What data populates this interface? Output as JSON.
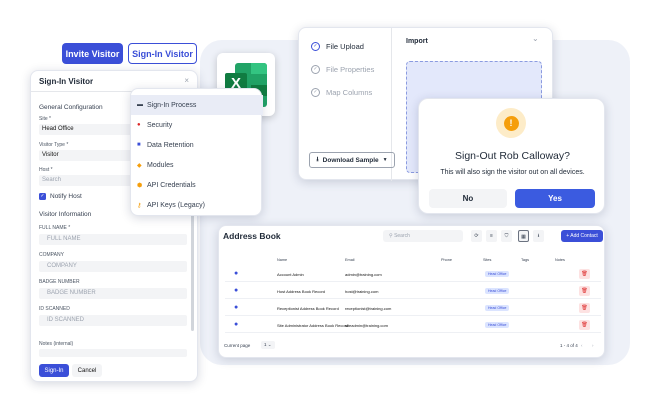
{
  "actions": {
    "invite": "Invite Visitor",
    "signin": "Sign-In Visitor"
  },
  "signin_dialog": {
    "title": "Sign-In Visitor",
    "close": "×",
    "general": "General Configuration",
    "site_label": "Site *",
    "site_value": "Head Office",
    "type_label": "Visitor Type *",
    "type_value": "Visitor",
    "host_label": "Host *",
    "host_placeholder": "Search",
    "notify": "Notify Host",
    "visitor_info": "Visitor Information",
    "full_name_label": "FULL NAME *",
    "full_name_ph": "FULL NAME",
    "company_label": "COMPANY",
    "company_ph": "COMPANY",
    "badge_label": "BADGE NUMBER",
    "badge_ph": "BADGE NUMBER",
    "id_label": "ID SCANNED",
    "id_ph": "ID SCANNED",
    "notes_label": "Notes (internal)",
    "signin_btn": "Sign-In",
    "cancel_btn": "Cancel"
  },
  "menu": [
    {
      "label": "Sign-In Process",
      "icon": "▬",
      "color": "#374151"
    },
    {
      "label": "Security",
      "icon": "●",
      "color": "#dc2626"
    },
    {
      "label": "Data Retention",
      "icon": "■",
      "color": "#3b4fd8"
    },
    {
      "label": "Modules",
      "icon": "◆",
      "color": "#f59e0b"
    },
    {
      "label": "API Credentials",
      "icon": "⬢",
      "color": "#f59e0b"
    },
    {
      "label": "API Keys (Legacy)",
      "icon": "🔑",
      "color": "#f59e0b"
    }
  ],
  "excel": {
    "letter": "X"
  },
  "import_dialog": {
    "steps": [
      "File Upload",
      "File Properties",
      "Map Columns"
    ],
    "import_label": "Import",
    "chevron": "⌄",
    "download": "Download Sample"
  },
  "signout": {
    "icon": "!",
    "title": "Sign-Out Rob Calloway?",
    "subtitle": "This will also sign the visitor out on all devices.",
    "no": "No",
    "yes": "Yes"
  },
  "address_book": {
    "title": "Address Book",
    "search_placeholder": "Search",
    "add": "+ Add Contact",
    "columns": [
      "Name",
      "Email",
      "Phone",
      "Sites",
      "Tags",
      "Notes"
    ],
    "rows": [
      {
        "name": "Account Admin",
        "email": "admin@training.com",
        "site": "Head Office"
      },
      {
        "name": "Host Address Book Record",
        "email": "host@training.com",
        "site": "Head Office"
      },
      {
        "name": "Receptionist Address Book Record",
        "email": "receptionist@training.com",
        "site": "Head Office"
      },
      {
        "name": "Site Administrator Address Book Record",
        "email": "siteadmin@training.com",
        "site": "Head Office"
      }
    ],
    "current_page_label": "Current page",
    "page": "1",
    "range": "1 - 4 of 4"
  }
}
